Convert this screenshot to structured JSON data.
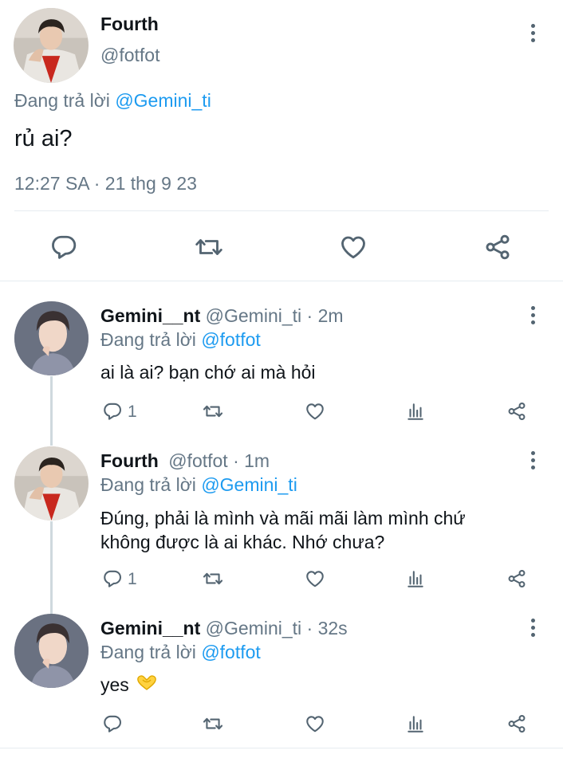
{
  "main_tweet": {
    "author_name": "Fourth",
    "author_handle": "@fotfot",
    "reply_prefix": "Đang trả lời",
    "reply_to": "@Gemini_ti",
    "text": "rủ ai?",
    "meta": "12:27 SA · 21 thg 9 23"
  },
  "replies": [
    {
      "name": "Gemini__nt",
      "handle_time": "@Gemini_ti · 2m",
      "reply_prefix": "Đang trả lời",
      "reply_to": "@fotfot",
      "text": "ai là ai? bạn chớ ai mà hỏi",
      "reply_count": "1"
    },
    {
      "name": "Fourth",
      "handle_time": "@fotfot · 1m",
      "reply_prefix": "Đang trả lời",
      "reply_to": "@Gemini_ti",
      "text_line1": "Đúng, phải là mình và mãi mãi làm mình chứ",
      "text_line2": "không được là ai khác. Nhớ chưa?",
      "reply_count": "1"
    },
    {
      "name": "Gemini__nt",
      "handle_time": "@Gemini_ti · 32s",
      "reply_prefix": "Đang trả lời",
      "reply_to": "@fotfot",
      "text": "yes",
      "emoji": "heart-hands-emoji",
      "reply_count": ""
    }
  ],
  "icons": {
    "reply": "reply-icon",
    "retweet": "retweet-icon",
    "like": "heart-icon",
    "views": "views-icon",
    "share": "share-icon",
    "more": "more-vertical-icon"
  },
  "colors": {
    "link": "#1d9bf0",
    "muted": "#657786",
    "icon": "#536471",
    "separator": "#e6ecf0"
  }
}
